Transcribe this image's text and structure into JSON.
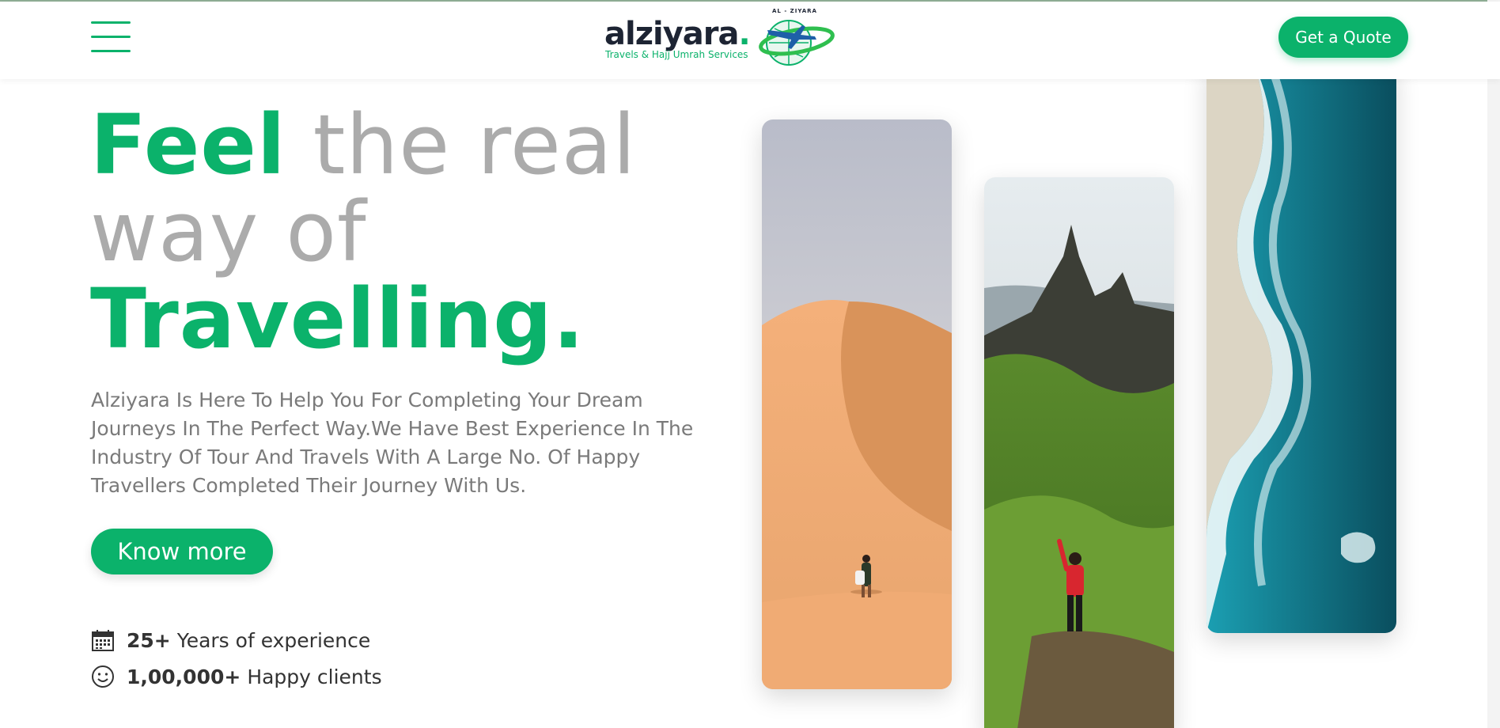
{
  "header": {
    "menu_label": "Menu",
    "logo": {
      "word": "alziyara",
      "dot": ".",
      "tagline": "Travels & Hajj Umrah  Services",
      "badge_text": "AL - ZIYARA"
    },
    "quote_button": "Get a Quote"
  },
  "hero": {
    "title_word1": "Feel",
    "title_rest1": " the real",
    "title_line2": "way of",
    "title_line3": "Travelling.",
    "description": "Alziyara Is Here To Help You For Completing Your Dream Journeys In The Perfect Way.We Have Best Experience In The Industry Of Tour And Travels With A Large No. Of Happy Travellers Completed Their Journey With Us.",
    "cta": "Know more"
  },
  "stats": [
    {
      "value": "25+",
      "label": "Years of experience",
      "icon": "calendar-icon"
    },
    {
      "value": "1,00,000+",
      "label": "Happy clients",
      "icon": "smiley-icon"
    }
  ],
  "gallery": [
    {
      "name": "desert-dunes-image"
    },
    {
      "name": "mountain-hiker-image"
    },
    {
      "name": "ocean-coast-image"
    }
  ],
  "colors": {
    "brand_green": "#0bb26b",
    "muted_grey": "#ababab",
    "text_dark": "#333333"
  }
}
